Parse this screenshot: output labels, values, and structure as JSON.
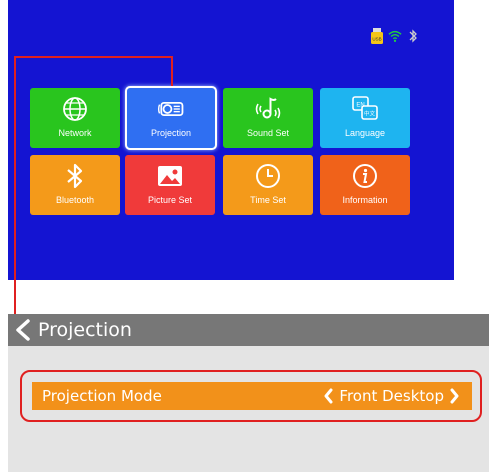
{
  "home": {
    "tiles": [
      {
        "label": "Network",
        "icon": "globe-icon",
        "color": "#29c51e"
      },
      {
        "label": "Projection",
        "icon": "projector-icon",
        "color": "#2f6ff2"
      },
      {
        "label": "Sound Set",
        "icon": "sound-icon",
        "color": "#29c51e"
      },
      {
        "label": "Language",
        "icon": "language-icon",
        "color": "#1eb4f0"
      },
      {
        "label": "Bluetooth",
        "icon": "bluetooth-icon",
        "color": "#f49a1a"
      },
      {
        "label": "Picture Set",
        "icon": "picture-icon",
        "color": "#f03a3a"
      },
      {
        "label": "Time Set",
        "icon": "clock-icon",
        "color": "#f49a1a"
      },
      {
        "label": "Information",
        "icon": "info-icon",
        "color": "#f0621a"
      }
    ],
    "status": {
      "usb_label": "USB",
      "icons": [
        "usb-icon",
        "wifi-icon",
        "bluetooth-icon"
      ]
    },
    "language_icon_text": {
      "en": "EN",
      "zh": "中文"
    },
    "background": "#1414d2"
  },
  "panel": {
    "title": "Projection",
    "setting_label": "Projection Mode",
    "setting_value": "Front Desktop",
    "accent": "#f2911a",
    "highlight": "#e02020"
  }
}
